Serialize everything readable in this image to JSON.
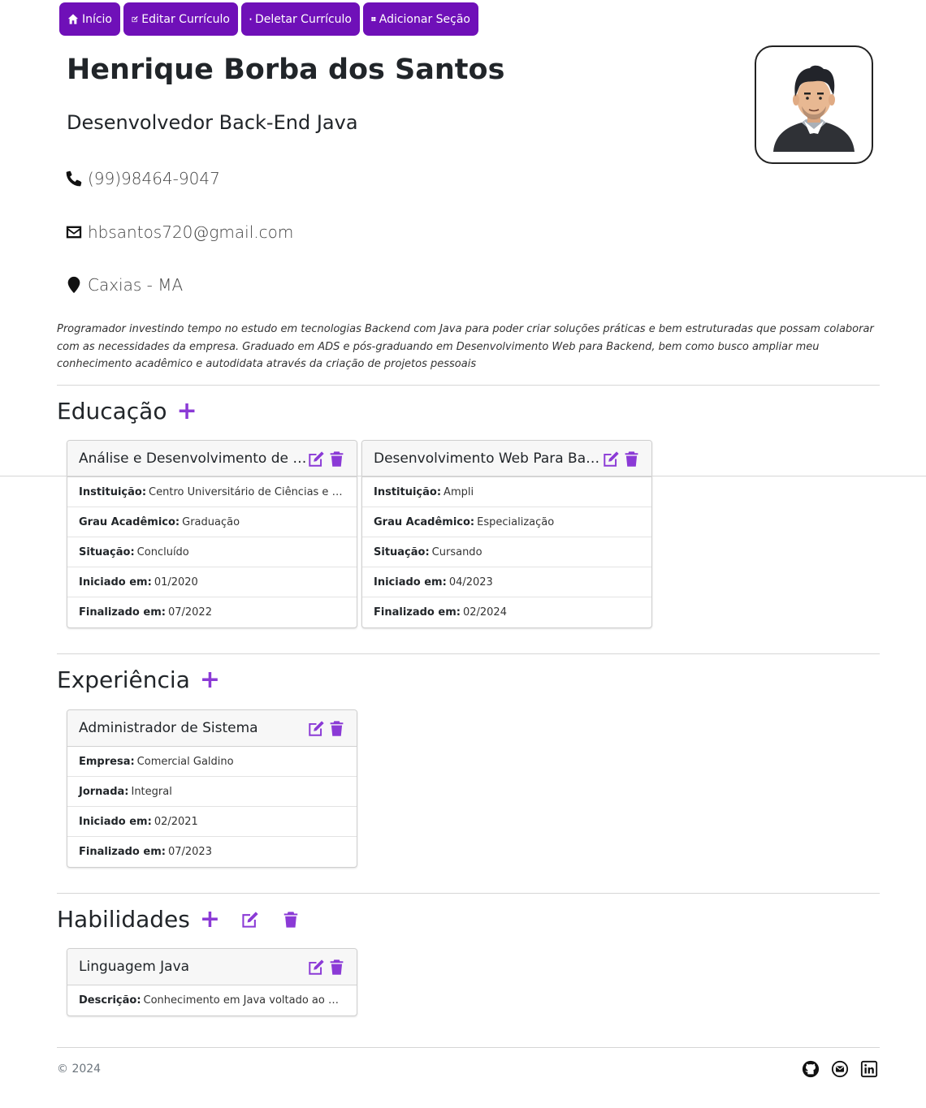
{
  "nav": {
    "items": [
      {
        "label": "Início",
        "icon": "home-icon"
      },
      {
        "label": "Editar Currículo",
        "icon": "edit-icon"
      },
      {
        "label": "Deletar Currículo",
        "icon": "trash-icon"
      },
      {
        "label": "Adicionar Seção",
        "icon": "windows-grid-icon"
      }
    ]
  },
  "profile": {
    "name": "Henrique Borba dos Santos",
    "role": "Desenvolvedor Back-End Java",
    "phone": "(99)98464-9047",
    "email": "hbsantos720@gmail.com",
    "location": "Caxias - MA",
    "summary": "Programador investindo tempo no estudo em tecnologias Backend com Java para poder criar soluções práticas e bem estruturadas que possam colaborar com as necessidades da empresa. Graduado em ADS e pós-graduando em Desenvolvimento Web para Backend, bem como busco ampliar meu conhecimento acadêmico e autodidata através da criação de projetos pessoais"
  },
  "education": {
    "title": "Educação",
    "cards": [
      {
        "title": "Análise e Desenvolvimento de S...",
        "rows": [
          {
            "label": "Instituição:",
            "value": "Centro Universitário de Ciências e Te..."
          },
          {
            "label": "Grau Acadêmico:",
            "value": "Graduação"
          },
          {
            "label": "Situação:",
            "value": "Concluído"
          },
          {
            "label": "Iniciado em:",
            "value": "01/2020"
          },
          {
            "label": "Finalizado em:",
            "value": "07/2022"
          }
        ]
      },
      {
        "title": "Desenvolvimento Web Para Bac...",
        "rows": [
          {
            "label": "Instituição:",
            "value": "Ampli"
          },
          {
            "label": "Grau Acadêmico:",
            "value": "Especialização"
          },
          {
            "label": "Situação:",
            "value": "Cursando"
          },
          {
            "label": "Iniciado em:",
            "value": "04/2023"
          },
          {
            "label": "Finalizado em:",
            "value": "02/2024"
          }
        ]
      }
    ]
  },
  "experience": {
    "title": "Experiência",
    "cards": [
      {
        "title": "Administrador de Sistema",
        "rows": [
          {
            "label": "Empresa:",
            "value": "Comercial Galdino"
          },
          {
            "label": "Jornada:",
            "value": "Integral"
          },
          {
            "label": "Iniciado em:",
            "value": "02/2021"
          },
          {
            "label": "Finalizado em:",
            "value": "07/2023"
          }
        ]
      }
    ]
  },
  "skills": {
    "title": "Habilidades",
    "cards": [
      {
        "title": "Linguagem Java",
        "rows": [
          {
            "label": "Descrição:",
            "value": "Conhecimento em Java voltado ao de..."
          }
        ]
      }
    ]
  },
  "footer": {
    "copyright": "© 2024",
    "icons": [
      "github-icon",
      "email-icon",
      "linkedin-icon"
    ]
  },
  "colors": {
    "nav_button": "#6f10b8",
    "accent_icon": "#8b3ad6"
  }
}
